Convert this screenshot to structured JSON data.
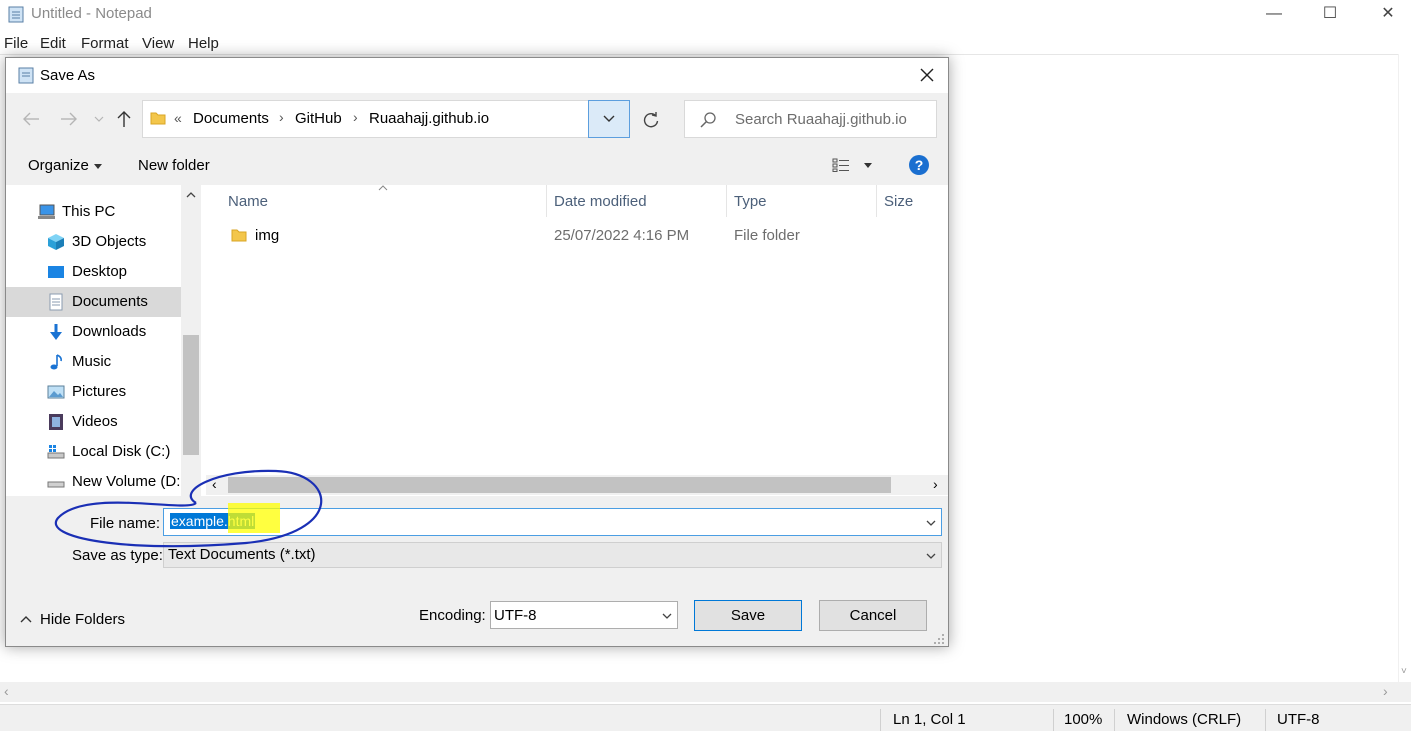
{
  "notepad": {
    "title": "Untitled - Notepad",
    "menu": [
      "File",
      "Edit",
      "Format",
      "View",
      "Help"
    ],
    "caption": {
      "minimize": "—",
      "maximize": "☐",
      "close": "✕"
    },
    "status": {
      "position": "Ln 1, Col 1",
      "zoom": "100%",
      "line_ending": "Windows (CRLF)",
      "encoding": "UTF-8"
    }
  },
  "dialog": {
    "title": "Save As",
    "breadcrumb": {
      "overflow": "«",
      "items": [
        "Documents",
        "GitHub",
        "Ruaahajj.github.io"
      ],
      "sep": "›"
    },
    "search_placeholder": "Search Ruaahajj.github.io",
    "toolbar": {
      "organize": "Organize",
      "new_folder": "New folder"
    },
    "nav": [
      {
        "label": "This PC",
        "icon": "pc-icon"
      },
      {
        "label": "3D Objects",
        "icon": "3d-objects-icon"
      },
      {
        "label": "Desktop",
        "icon": "desktop-icon"
      },
      {
        "label": "Documents",
        "icon": "documents-icon",
        "selected": true
      },
      {
        "label": "Downloads",
        "icon": "downloads-icon"
      },
      {
        "label": "Music",
        "icon": "music-icon"
      },
      {
        "label": "Pictures",
        "icon": "pictures-icon"
      },
      {
        "label": "Videos",
        "icon": "videos-icon"
      },
      {
        "label": "Local Disk (C:)",
        "icon": "local-disk-icon"
      },
      {
        "label": "New Volume (D:",
        "icon": "drive-icon"
      }
    ],
    "columns": [
      "Name",
      "Date modified",
      "Type",
      "Size"
    ],
    "files": [
      {
        "name": "img",
        "date": "25/07/2022 4:16 PM",
        "type": "File folder",
        "size": ""
      }
    ],
    "file_name_label": "File name:",
    "file_name_value": "example.html",
    "save_type_label": "Save as type:",
    "save_type_value": "Text Documents (*.txt)",
    "hide_folders": "Hide Folders",
    "encoding_label": "Encoding:",
    "encoding_value": "UTF-8",
    "save": "Save",
    "cancel": "Cancel"
  },
  "colors": {
    "accent": "#0078d7",
    "selection": "#0078d7",
    "highlight": "#ffff00",
    "annotation": "#1a2fb5"
  }
}
